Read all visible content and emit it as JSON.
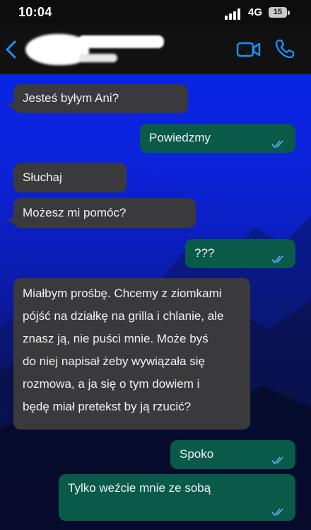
{
  "status": {
    "time": "10:04",
    "network": "4G",
    "battery": "15"
  },
  "header": {
    "contact_name": "",
    "contact_status": ""
  },
  "messages": [
    {
      "dir": "in",
      "text": "Jesteś byłym Ani?"
    },
    {
      "dir": "out",
      "text": "Powiedzmy"
    },
    {
      "dir": "in",
      "text": "Słuchaj"
    },
    {
      "dir": "in",
      "text": "Możesz mi pomóc?"
    },
    {
      "dir": "out",
      "text": "???"
    },
    {
      "dir": "in",
      "lines": [
        "Miałbym prośbę. Chcemy z ziomkami",
        "pójść na działkę na grilla i chlanie, ale",
        "znasz ją, nie puści mnie. Może byś",
        "do niej napisał żeby wywiązała się",
        "rozmowa, a ja się o tym dowiem i",
        "będę miał pretekst by ją rzucić?"
      ]
    },
    {
      "dir": "out",
      "text": "Spoko"
    },
    {
      "dir": "out",
      "text": "Tylko weźcie mnie ze sobą"
    }
  ],
  "colors": {
    "incoming_bubble": "#3a3a3c",
    "outgoing_bubble": "#0a5a4a",
    "accent": "#1e90ff",
    "read_ticks": "#5ab4ff"
  }
}
